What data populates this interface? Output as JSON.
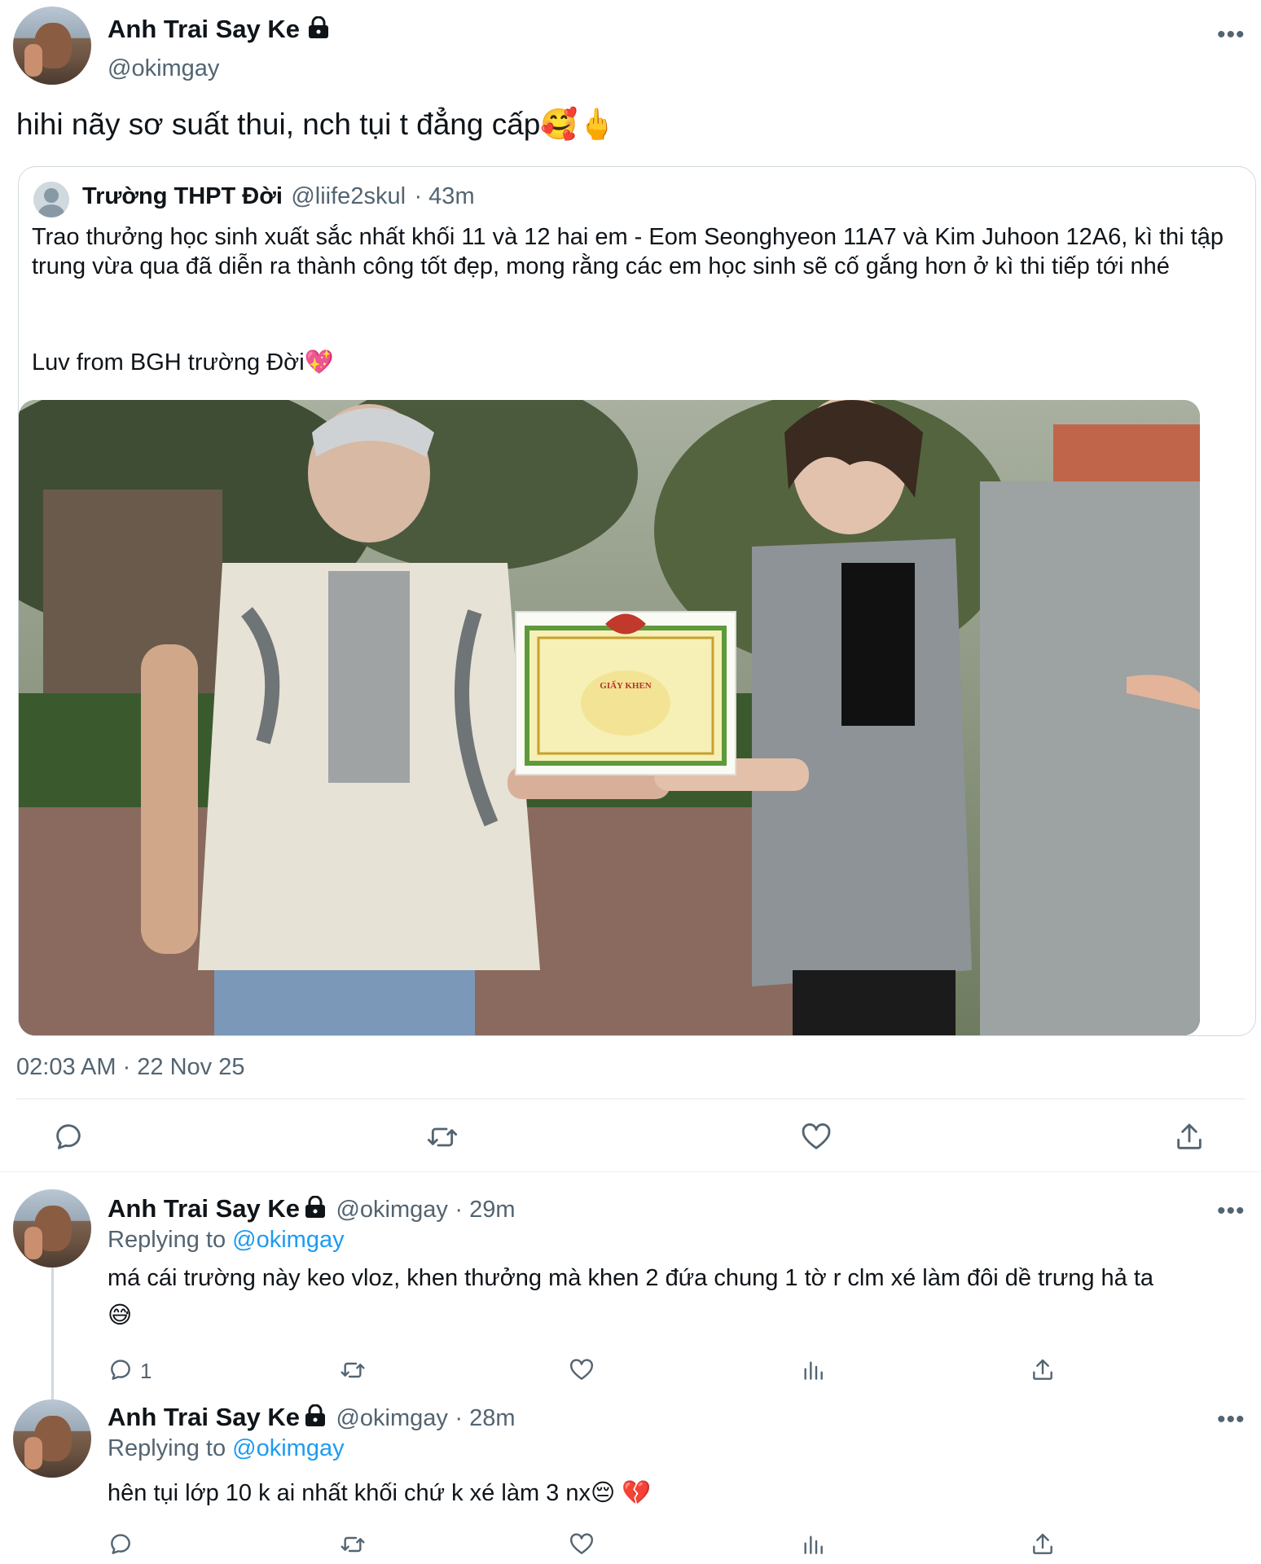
{
  "main_tweet": {
    "author_name": "Anh Trai Say Ke",
    "author_handle": "@okimgay",
    "more_label": "•••",
    "text": "hihi nãy sơ suất thui, nch tụi t đẳng cấp🥰🖕",
    "timestamp": "02:03 AM · 22 Nov 25",
    "quoted": {
      "author_name": "Trường THPT Đời",
      "author_handle": "@liife2skul",
      "time": "· 43m",
      "text": "Trao thưởng học sinh xuất sắc nhất khối 11 và 12 hai em - Eom Seonghyeon 11A7 và Kim Juhoon 12A6, kì thi tập trung vừa qua đã diễn ra thành công tốt đẹp, mong rằng các em học sinh sẽ cố gắng hơn ở kì thi tiếp tới nhé",
      "signoff": "Luv from BGH trường Đời💖",
      "image_certificate_text": "GIẤY KHEN"
    },
    "actions": [
      "reply-icon",
      "retweet-icon",
      "like-icon",
      "share-icon"
    ]
  },
  "replies": [
    {
      "author_name": "Anh Trai Say Ke",
      "author_handle": "@okimgay",
      "time": "· 29m",
      "replying_prefix": "Replying to",
      "replying_to": "@okimgay",
      "text": "má cái trường này keo vloz, khen thưởng mà khen 2 đứa chung 1 tờ r clm xé làm đôi dề trưng hả ta",
      "emoji_line": "😅",
      "reply_count": "1"
    },
    {
      "author_name": "Anh Trai Say Ke",
      "author_handle": "@okimgay",
      "time": "· 28m",
      "replying_prefix": "Replying to",
      "replying_to": "@okimgay",
      "text": "hên tụi lớp 10 k ai nhất khối chứ k xé làm 3 nx😔 💔",
      "reply_count": ""
    }
  ],
  "colors": {
    "text": "#0f1419",
    "secondary": "#536471",
    "link": "#1d9bf0",
    "border": "#cfd9de",
    "separator": "#eff3f4"
  }
}
